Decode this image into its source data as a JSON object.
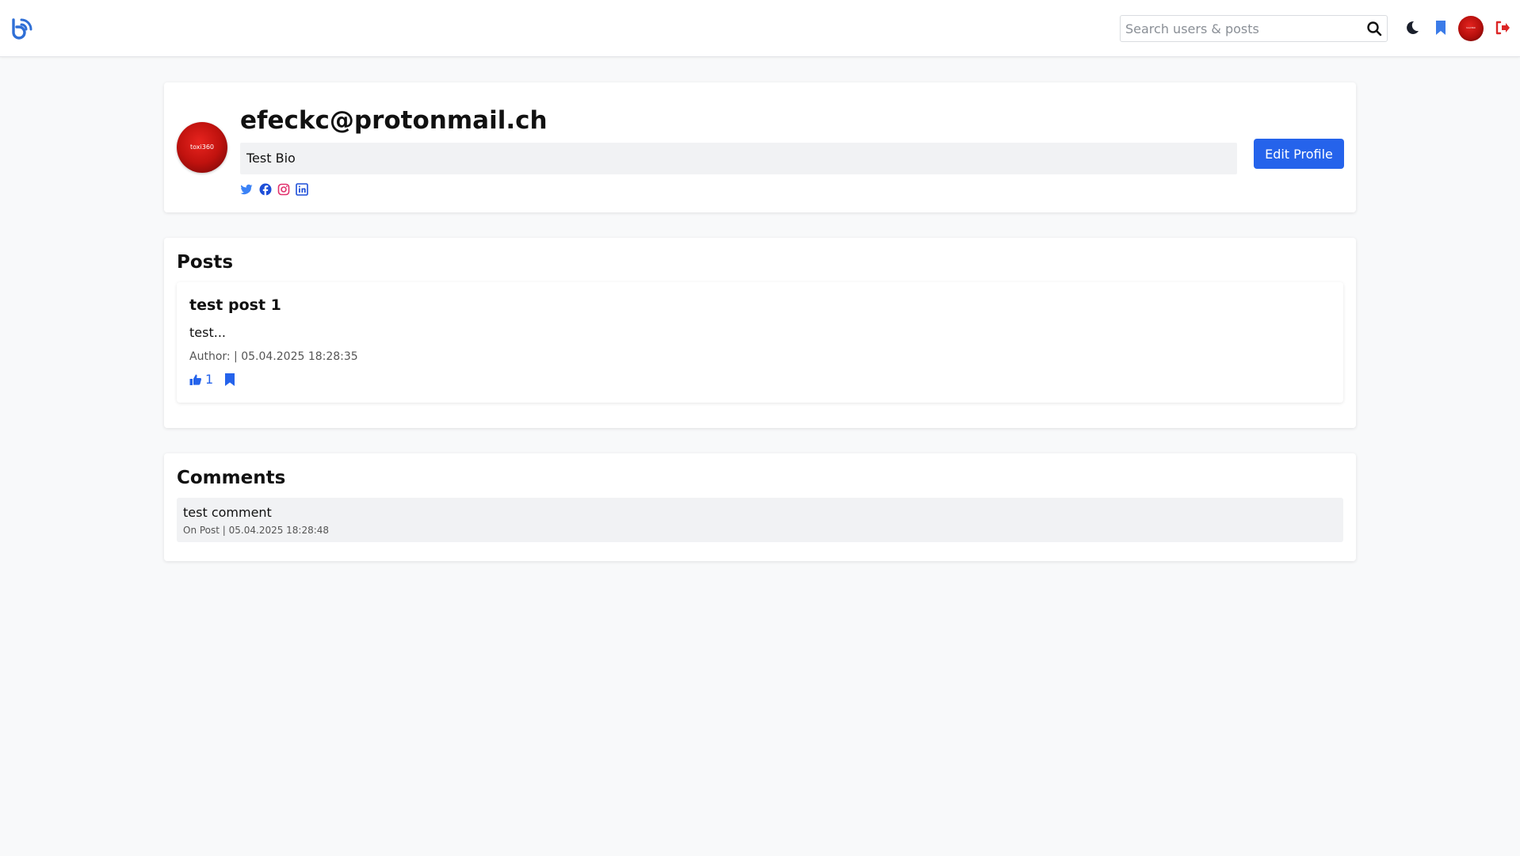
{
  "header": {
    "search_placeholder": "Search users & posts",
    "avatar_text": "toxi360"
  },
  "profile": {
    "username": "efeckc@protonmail.ch",
    "bio": "Test Bio",
    "avatar_text": "toxi360",
    "edit_label": "Edit Profile",
    "socials": [
      "twitter-icon",
      "facebook-icon",
      "instagram-icon",
      "linkedin-icon"
    ]
  },
  "posts": {
    "title": "Posts",
    "items": [
      {
        "title": "test post 1",
        "excerpt": "test...",
        "meta": "Author: | 05.04.2025 18:28:35",
        "likes": "1"
      }
    ]
  },
  "comments": {
    "title": "Comments",
    "items": [
      {
        "text": "test comment",
        "meta": "On Post | 05.04.2025 18:28:48"
      }
    ]
  },
  "colors": {
    "accent": "#2563eb",
    "logout": "#dc2626",
    "instagram": "#e1306c"
  }
}
